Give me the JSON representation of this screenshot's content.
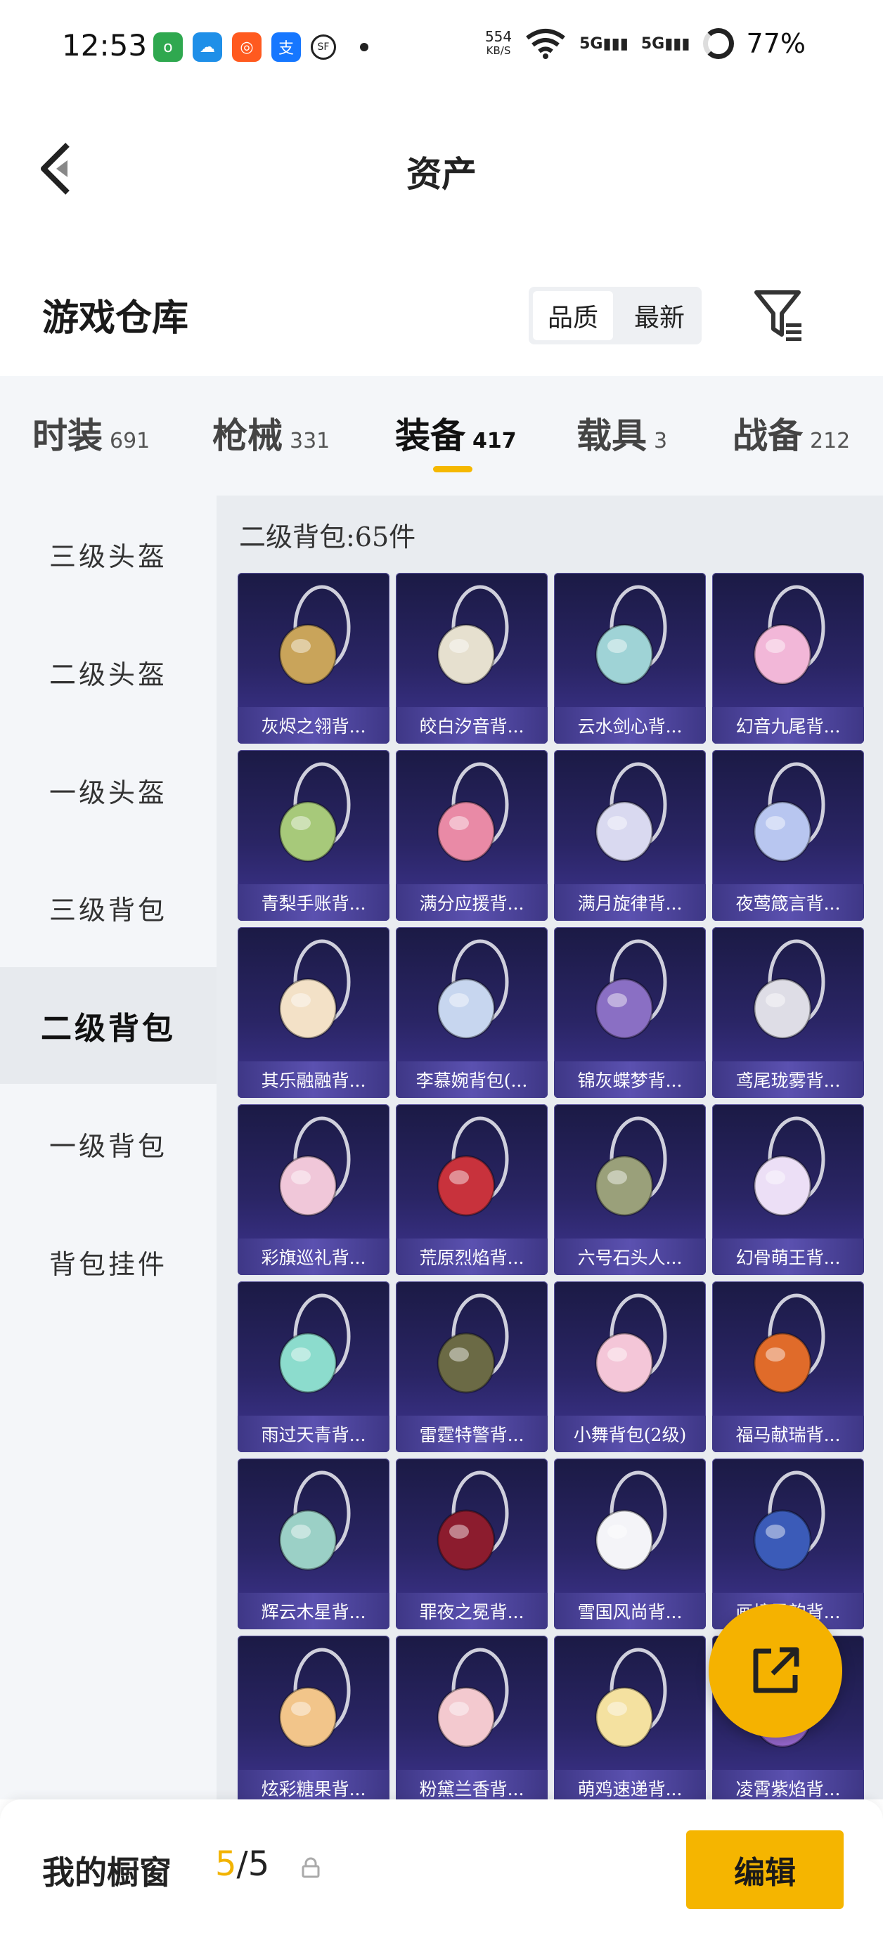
{
  "status_bar": {
    "time": "12:53",
    "speed_value": "554",
    "speed_unit": "KB/S",
    "network1": "5G",
    "network2": "5G",
    "battery": "77%"
  },
  "header": {
    "title": "资产"
  },
  "warehouse": {
    "title": "游戏仓库",
    "sort_options": [
      "品质",
      "最新"
    ],
    "selected_sort": "品质"
  },
  "tabs": [
    {
      "label": "时装",
      "count": "691"
    },
    {
      "label": "枪械",
      "count": "331"
    },
    {
      "label": "装备",
      "count": "417",
      "active": true
    },
    {
      "label": "载具",
      "count": "3"
    },
    {
      "label": "战备",
      "count": "212"
    }
  ],
  "sidebar": {
    "items": [
      "三级头盔",
      "二级头盔",
      "一级头盔",
      "三级背包",
      "二级背包",
      "一级背包",
      "背包挂件"
    ],
    "active": "二级背包"
  },
  "content": {
    "header": "二级背包:65件",
    "items": [
      {
        "name": "灰烬之翎背...",
        "color": "#c9a45a"
      },
      {
        "name": "皎白汐音背...",
        "color": "#e6e0cf"
      },
      {
        "name": "云水剑心背...",
        "color": "#9fd3d6"
      },
      {
        "name": "幻音九尾背...",
        "color": "#f2b7d8"
      },
      {
        "name": "青梨手账背...",
        "color": "#a7c97a"
      },
      {
        "name": "满分应援背...",
        "color": "#e98aa6"
      },
      {
        "name": "满月旋律背...",
        "color": "#d9d9f0"
      },
      {
        "name": "夜莺箴言背...",
        "color": "#b8c6f0"
      },
      {
        "name": "其乐融融背...",
        "color": "#f3e1c7"
      },
      {
        "name": "李慕婉背包(...",
        "color": "#c7d6ef"
      },
      {
        "name": "锦灰蝶梦背...",
        "color": "#8a6fc4"
      },
      {
        "name": "鸢尾珑雾背...",
        "color": "#dedde6"
      },
      {
        "name": "彩旗巡礼背...",
        "color": "#f0c7d9"
      },
      {
        "name": "荒原烈焰背...",
        "color": "#c8323c"
      },
      {
        "name": "六号石头人...",
        "color": "#9aa07a"
      },
      {
        "name": "幻骨萌王背...",
        "color": "#ecdff6"
      },
      {
        "name": "雨过天青背...",
        "color": "#8cdccd"
      },
      {
        "name": "雷霆特警背...",
        "color": "#6b6a45"
      },
      {
        "name": "小舞背包(2级)",
        "color": "#f4c6d8"
      },
      {
        "name": "福马献瑞背...",
        "color": "#e06b2a"
      },
      {
        "name": "辉云木星背...",
        "color": "#9bd0c6"
      },
      {
        "name": "罪夜之冕背...",
        "color": "#8c1c2e"
      },
      {
        "name": "雪国风尚背...",
        "color": "#f4f4f8"
      },
      {
        "name": "画境灵韵背...",
        "color": "#3b5bb8"
      },
      {
        "name": "炫彩糖果背...",
        "color": "#f2c58a"
      },
      {
        "name": "粉黛兰香背...",
        "color": "#f3c9cf"
      },
      {
        "name": "萌鸡速递背...",
        "color": "#f4e1a0"
      },
      {
        "name": "凌霄紫焰背...",
        "color": "#9b6bd4"
      }
    ]
  },
  "showcase": {
    "label": "我的橱窗",
    "used": "5",
    "separator": "/",
    "total": "5",
    "edit_label": "编辑"
  },
  "colors": {
    "accent": "#f5b500",
    "card_bg": "#2a2565"
  }
}
